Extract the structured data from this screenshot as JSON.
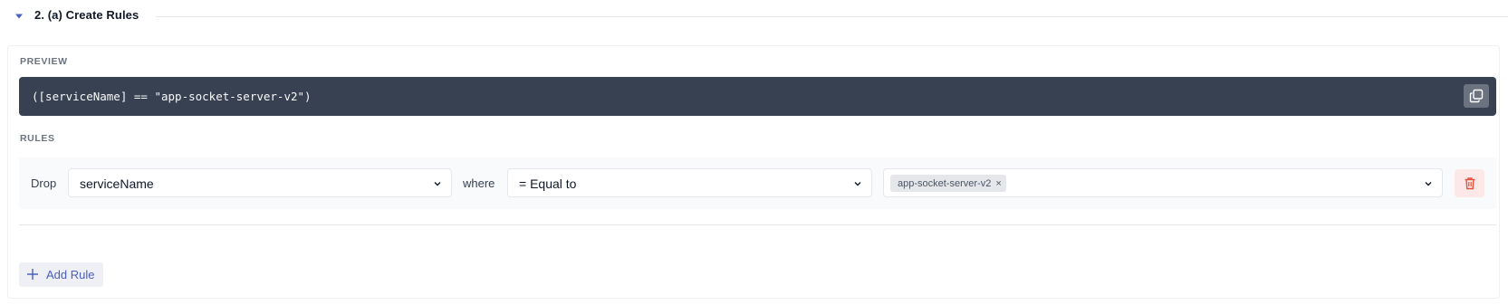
{
  "section": {
    "title": "2. (a) Create Rules",
    "collapse_icon": "caret-down-icon"
  },
  "preview": {
    "label": "PREVIEW",
    "code": "([serviceName] == \"app-socket-server-v2\")",
    "copy_icon": "copy-icon"
  },
  "rules": {
    "label": "RULES",
    "items": [
      {
        "action": "Drop",
        "field": "serviceName",
        "connector": "where",
        "operator": "= Equal to",
        "values": [
          "app-socket-server-v2"
        ],
        "chip_remove": "×",
        "delete_icon": "trash-icon"
      }
    ],
    "add_label": "Add Rule",
    "add_icon": "plus-icon"
  },
  "colors": {
    "accent": "#4a5fc1",
    "preview_bg": "#374151",
    "danger": "#e0533c",
    "danger_bg": "#fde8e8"
  }
}
